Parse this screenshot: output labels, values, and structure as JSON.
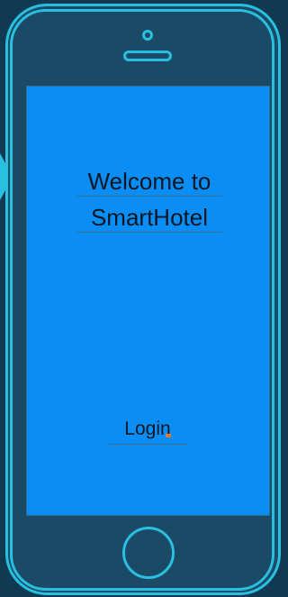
{
  "welcome": {
    "line1": "Welcome to",
    "line2": "SmartHotel"
  },
  "login": {
    "label": "Login"
  },
  "colors": {
    "screen": "#0a8ef5",
    "frame": "#1b4a66",
    "accent": "#29c0e0",
    "background": "#0f3a52"
  }
}
